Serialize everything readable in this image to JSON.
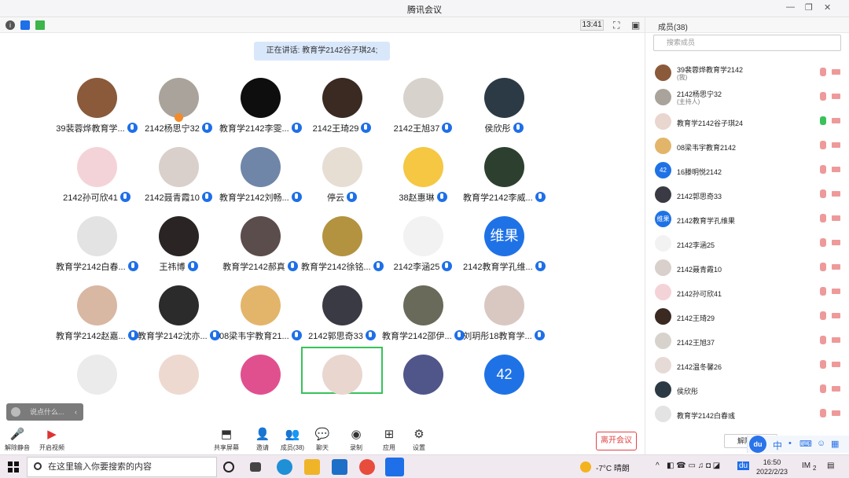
{
  "window": {
    "title": "腾讯会议"
  },
  "topbar": {
    "time": "13:41"
  },
  "speaking": "正在讲话: 教育学2142谷子琪24;",
  "tiles": [
    {
      "name": "39裴蓉烨教育学...",
      "color": "#8a5a3a",
      "host": false
    },
    {
      "name": "2142杨思宁32",
      "color": "#a9a39b",
      "host": true
    },
    {
      "name": "教育学2142李雯...",
      "color": "#0e0e0e",
      "host": false
    },
    {
      "name": "2142王琦29",
      "color": "#3b2a22",
      "host": false
    },
    {
      "name": "2142王旭37",
      "color": "#d8d2cc",
      "host": false
    },
    {
      "name": "侯欣彤",
      "color": "#2b3a44",
      "host": false
    },
    {
      "name": "2142孙可欣41",
      "color": "#f4d3d8",
      "host": false
    },
    {
      "name": "2142聂青霞10",
      "color": "#d9cfcb",
      "host": false
    },
    {
      "name": "教育学2142刘畅...",
      "color": "#6f86a8",
      "host": false
    },
    {
      "name": "停云",
      "color": "#e6ddd3",
      "host": false
    },
    {
      "name": "38赵惠琳",
      "color": "#f5c742",
      "host": false
    },
    {
      "name": "教育学2142李威...",
      "color": "#2d4030",
      "host": false
    },
    {
      "name": "教育学2142白春...",
      "color": "#e3e3e3",
      "host": false
    },
    {
      "name": "王祎博",
      "color": "#2a2424",
      "host": false
    },
    {
      "name": "教育学2142郝真",
      "color": "#5b4d4b",
      "host": false
    },
    {
      "name": "教育学2142徐铭...",
      "color": "#b3933f",
      "host": false
    },
    {
      "name": "2142李涵25",
      "color": "#f2f2f2",
      "host": false
    },
    {
      "name": "2142教育学孔维...",
      "color": "#1f72e6",
      "host": false,
      "text": "维果"
    },
    {
      "name": "教育学2142赵嘉...",
      "color": "#d8b7a3",
      "host": false
    },
    {
      "name": "教育学2142沈亦...",
      "color": "#2b2b2b",
      "host": false
    },
    {
      "name": "08梁韦宇教育21...",
      "color": "#e3b56a",
      "host": false
    },
    {
      "name": "2142郭思奇33",
      "color": "#3a3a44",
      "host": false
    },
    {
      "name": "教育学2142邵伊...",
      "color": "#6a6a5a",
      "host": false
    },
    {
      "name": "刘玥彤18教育学...",
      "color": "#d9c8c2",
      "host": false
    },
    {
      "name": "",
      "color": "#ebebeb",
      "host": false
    },
    {
      "name": "",
      "color": "#eed9d0",
      "host": false
    },
    {
      "name": "",
      "color": "#e0508f",
      "host": false
    },
    {
      "name": "",
      "color": "#e9d6cf",
      "host": false
    },
    {
      "name": "",
      "color": "#50568a",
      "host": false
    },
    {
      "name": "",
      "color": "#1f72e6",
      "host": false,
      "text": "42"
    }
  ],
  "chat_placeholder": "说点什么...",
  "toolbar": {
    "mute": "解除静音",
    "video": "开启视频",
    "share": "共享屏幕",
    "invite": "邀请",
    "members": "成员(38)",
    "chat": "聊天",
    "record": "录制",
    "apps": "应用",
    "settings": "设置",
    "leave": "离开会议"
  },
  "panel": {
    "title": "成员(38)",
    "search_placeholder": "搜索成员",
    "mute_all": "解除",
    "members": [
      {
        "name": "39裴蓉烨教育学2142",
        "sub": "(我)",
        "color": "#8a5a3a",
        "talking": false
      },
      {
        "name": "2142杨思宁32",
        "sub": "(主持人)",
        "color": "#a9a39b",
        "talking": false
      },
      {
        "name": "教育学2142谷子琪24",
        "sub": "",
        "color": "#e9d6cf",
        "talking": true
      },
      {
        "name": "08梁韦宇教育2142",
        "sub": "",
        "color": "#e3b56a",
        "talking": false
      },
      {
        "name": "16滕明悦2142",
        "sub": "",
        "color": "#1f72e6",
        "talking": false,
        "text": "42"
      },
      {
        "name": "2142郭思奇33",
        "sub": "",
        "color": "#3a3a44",
        "talking": false
      },
      {
        "name": "2142教育学孔维果",
        "sub": "",
        "color": "#1f72e6",
        "talking": false,
        "text": "维果"
      },
      {
        "name": "2142李涵25",
        "sub": "",
        "color": "#f2f2f2",
        "talking": false
      },
      {
        "name": "2142聂青霞10",
        "sub": "",
        "color": "#d9cfcb",
        "talking": false
      },
      {
        "name": "2142孙可欣41",
        "sub": "",
        "color": "#f4d3d8",
        "talking": false
      },
      {
        "name": "2142王琦29",
        "sub": "",
        "color": "#3b2a22",
        "talking": false
      },
      {
        "name": "2142王旭37",
        "sub": "",
        "color": "#d8d2cc",
        "talking": false
      },
      {
        "name": "2142温冬馨26",
        "sub": "",
        "color": "#e5dad6",
        "talking": false
      },
      {
        "name": "侯欣彤",
        "sub": "",
        "color": "#2b3a44",
        "talking": false
      },
      {
        "name": "教育学2142白春彧",
        "sub": "",
        "color": "#e3e3e3",
        "talking": false
      }
    ]
  },
  "ime": {
    "logo": "du",
    "lang": "中"
  },
  "taskbar": {
    "search_placeholder": "在这里输入你要搜索的内容",
    "weather": "-7°C 晴朗",
    "time": "16:50",
    "date": "2022/2/23",
    "notif": "2"
  }
}
